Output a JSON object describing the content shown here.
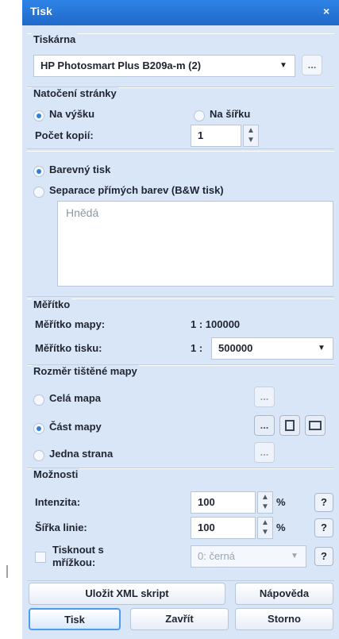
{
  "window": {
    "title": "Tisk",
    "close": "×"
  },
  "printer": {
    "section_title": "Tiskárna",
    "selected": "HP Photosmart Plus B209a-m (2)",
    "more_button": "..."
  },
  "orientation": {
    "section_title": "Natočení stránky",
    "portrait_label": "Na výšku",
    "landscape_label": "Na šířku",
    "copies_label": "Počet kopií:",
    "copies_value": "1"
  },
  "color": {
    "color_print_label": "Barevný tisk",
    "separation_label": "Separace přímých barev (B&W tisk)",
    "separation_value": "Hnědá"
  },
  "scale": {
    "section_title": "Měřítko",
    "map_scale_label": "Měřítko mapy:",
    "map_scale_value": "1 : 100000",
    "print_scale_label": "Měřítko tisku:",
    "print_scale_prefix": "1 :",
    "print_scale_value": "500000"
  },
  "map_size": {
    "section_title": "Rozměr tištěné mapy",
    "whole_map_label": "Celá mapa",
    "part_map_label": "Část mapy",
    "one_page_label": "Jedna strana",
    "button_ellipsis": "..."
  },
  "options": {
    "section_title": "Možnosti",
    "intensity_label": "Intenzita:",
    "intensity_value": "100",
    "line_width_label": "Šířka linie:",
    "line_width_value": "100",
    "percent": "%",
    "grid_label_line1": "Tisknout s",
    "grid_label_line2": "mřížkou:",
    "grid_value": "0: černá",
    "help": "?"
  },
  "buttons": {
    "save_xml": "Uložit XML skript",
    "help": "Nápověda",
    "print": "Tisk",
    "close": "Zavřít",
    "cancel": "Storno"
  }
}
